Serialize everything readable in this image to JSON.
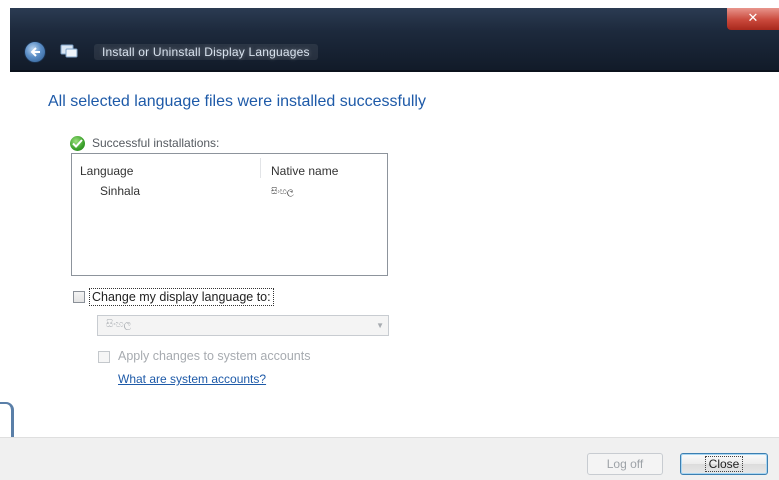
{
  "window": {
    "title": "Install or Uninstall Display Languages",
    "close_symbol": "✕"
  },
  "heading": "All selected language files were installed successfully",
  "success_label": "Successful installations:",
  "table": {
    "columns": [
      "Language",
      "Native name"
    ],
    "rows": [
      {
        "language": "Sinhala",
        "native_name": "සිංහල"
      }
    ]
  },
  "change_language": {
    "label": "Change my display language to:",
    "checked": false
  },
  "language_select": {
    "value": "සිංහල",
    "enabled": false
  },
  "apply_system": {
    "label": "Apply changes to system accounts",
    "checked": false,
    "enabled": false
  },
  "link_text": "What are system accounts?",
  "buttons": {
    "log_off": "Log off",
    "close": "Close"
  },
  "icons": {
    "back": "back-arrow-icon",
    "app": "language-icon",
    "success": "green-check-icon"
  },
  "colors": {
    "heading": "#1e5aa8",
    "link": "#1e5aa8",
    "titlebar": "#1d2a3d"
  }
}
